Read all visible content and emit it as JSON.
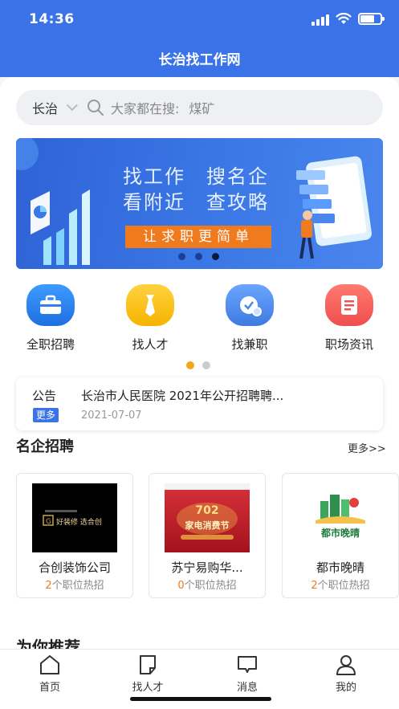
{
  "status_bar": {
    "time": "14:36"
  },
  "app": {
    "title": "长治找工作网"
  },
  "search": {
    "city": "长治",
    "hint": "大家都在搜:",
    "keyword": "煤矿"
  },
  "banner": {
    "line1": "找工作　搜名企",
    "line2": "看附近　查攻略",
    "cta": "让求职更简单",
    "active_slide": 3,
    "slide_count": 3
  },
  "categories": [
    {
      "label": "全职招聘",
      "icon": "briefcase-icon",
      "color": "#2f80ed"
    },
    {
      "label": "找人才",
      "icon": "tie-icon",
      "color": "#f5b400"
    },
    {
      "label": "找兼职",
      "icon": "clock-icon",
      "color": "#4d86e8"
    },
    {
      "label": "职场资讯",
      "icon": "news-icon",
      "color": "#ef5350"
    }
  ],
  "notice": {
    "title": "公告",
    "tag": "更多",
    "text": "长治市人民医院 2021年公开招聘聘...",
    "date": "2021-07-07"
  },
  "featured": {
    "title": "名企招聘",
    "more": "更多>>",
    "companies": [
      {
        "name": "合创装饰公司",
        "count": "2",
        "jobs_suffix": "个职位热招",
        "logo_text": "好装修 选合创"
      },
      {
        "name": "苏宁易购华...",
        "count": "0",
        "jobs_suffix": "个职位热招",
        "logo_text": "702 苏宁易购 家电消费节"
      },
      {
        "name": "都市晚晴",
        "count": "2",
        "jobs_suffix": "个职位热招",
        "logo_text": "都市晚晴"
      }
    ]
  },
  "recommend": {
    "title": "为你推荐"
  },
  "tabbar": [
    {
      "label": "首页",
      "icon": "home-icon"
    },
    {
      "label": "找人才",
      "icon": "talent-icon"
    },
    {
      "label": "消息",
      "icon": "message-icon"
    },
    {
      "label": "我的",
      "icon": "profile-icon"
    }
  ]
}
